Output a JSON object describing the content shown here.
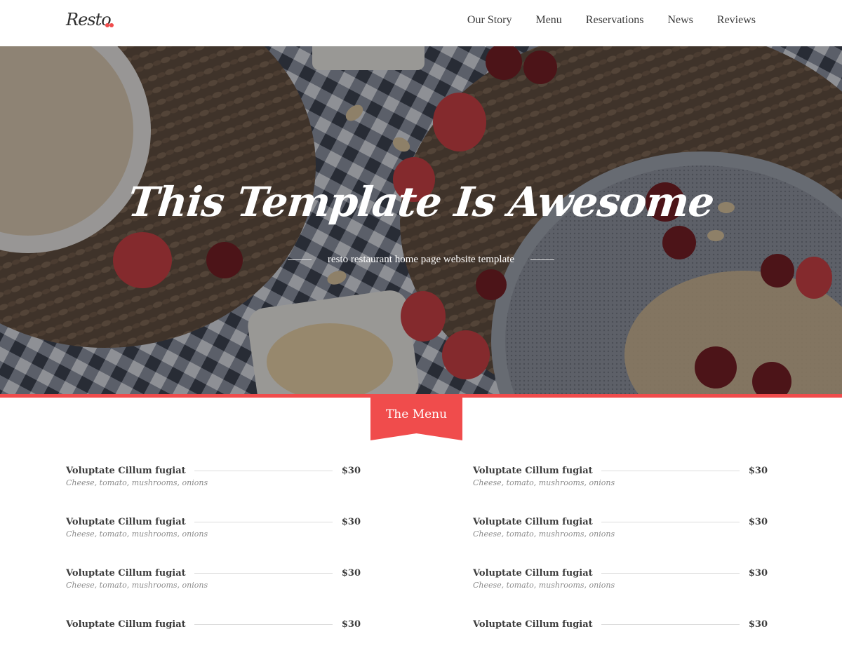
{
  "header": {
    "logo": "Resto",
    "nav": [
      {
        "label": "Our Story"
      },
      {
        "label": "Menu"
      },
      {
        "label": "Reservations"
      },
      {
        "label": "News"
      },
      {
        "label": "Reviews"
      }
    ]
  },
  "hero": {
    "title": "This Template Is Awesome",
    "subtitle": "resto restaurant home page website template"
  },
  "menu_section": {
    "title": "The Menu",
    "left_items": [
      {
        "name": "Voluptate Cillum fugiat",
        "desc": "Cheese, tomato, mushrooms, onions",
        "price": "$30"
      },
      {
        "name": "Voluptate Cillum fugiat",
        "desc": "Cheese, tomato, mushrooms, onions",
        "price": "$30"
      },
      {
        "name": "Voluptate Cillum fugiat",
        "desc": "Cheese, tomato, mushrooms, onions",
        "price": "$30"
      },
      {
        "name": "Voluptate Cillum fugiat",
        "desc": "",
        "price": "$30"
      }
    ],
    "right_items": [
      {
        "name": "Voluptate Cillum fugiat",
        "desc": "Cheese, tomato, mushrooms, onions",
        "price": "$30"
      },
      {
        "name": "Voluptate Cillum fugiat",
        "desc": "Cheese, tomato, mushrooms, onions",
        "price": "$30"
      },
      {
        "name": "Voluptate Cillum fugiat",
        "desc": "Cheese, tomato, mushrooms, onions",
        "price": "$30"
      },
      {
        "name": "Voluptate Cillum fugiat",
        "desc": "",
        "price": "$30"
      }
    ]
  },
  "colors": {
    "accent": "#f04c4c",
    "text": "#3c3c3c",
    "muted": "#8b8b8b"
  }
}
